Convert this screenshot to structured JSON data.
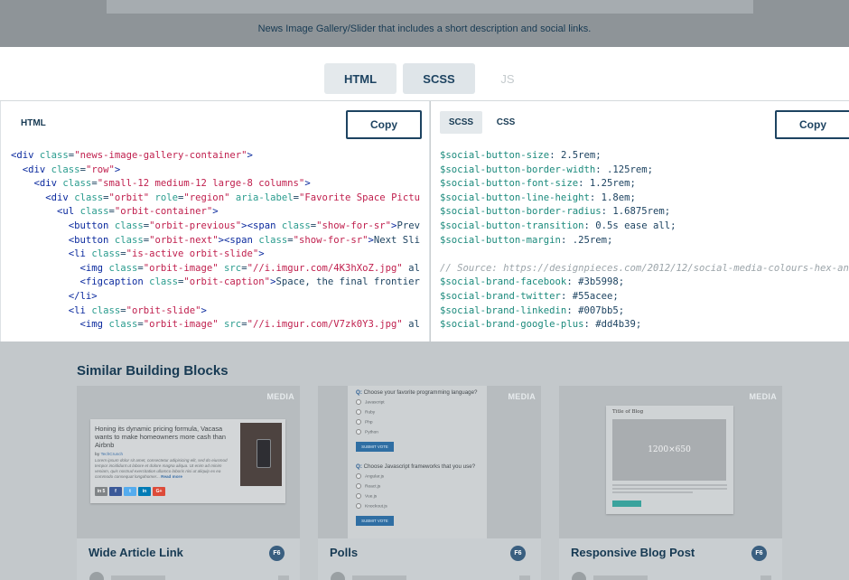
{
  "header": {
    "description": "News Image Gallery/Slider that includes a short description and social links."
  },
  "tabs": [
    {
      "label": "HTML",
      "active": false
    },
    {
      "label": "SCSS",
      "active": true
    },
    {
      "label": "JS",
      "active": false,
      "disabled": true
    }
  ],
  "html_panel": {
    "label": "HTML",
    "copy_label": "Copy",
    "lines": [
      "<div class=\"news-image-gallery-container\">",
      "  <div class=\"row\">",
      "    <div class=\"small-12 medium-12 large-8 columns\">",
      "      <div class=\"orbit\" role=\"region\" aria-label=\"Favorite Space Pictu",
      "        <ul class=\"orbit-container\">",
      "          <button class=\"orbit-previous\"><span class=\"show-for-sr\">Prev",
      "          <button class=\"orbit-next\"><span class=\"show-for-sr\">Next Sli",
      "          <li class=\"is-active orbit-slide\">",
      "            <img class=\"orbit-image\" src=\"//i.imgur.com/4K3hXoZ.jpg\" al",
      "            <figcaption class=\"orbit-caption\">Space, the final frontier",
      "          </li>",
      "          <li class=\"orbit-slide\">",
      "            <img class=\"orbit-image\" src=\"//i.imgur.com/V7zk0Y3.jpg\" al"
    ]
  },
  "scss_panel": {
    "sub_tabs": [
      "SCSS",
      "CSS"
    ],
    "copy_label": "Copy",
    "lines": [
      "$social-button-size: 2.5rem;",
      "$social-button-border-width: .125rem;",
      "$social-button-font-size: 1.25rem;",
      "$social-button-line-height: 1.8em;",
      "$social-button-border-radius: 1.6875rem;",
      "$social-button-transition: 0.5s ease all;",
      "$social-button-margin: .25rem;",
      "",
      "// Source: https://designpieces.com/2012/12/social-media-colours-hex-an",
      "$social-brand-facebook: #3b5998;",
      "$social-brand-twitter: #55acee;",
      "$social-brand-linkedin: #007bb5;",
      "$social-brand-google-plus: #dd4b39;"
    ]
  },
  "similar": {
    "title": "Similar Building Blocks",
    "cards": [
      {
        "title": "Wide Article Link",
        "tag": "MEDIA",
        "badge": "F6",
        "preview": {
          "headline": "Honing its dynamic pricing formula, Vacasa wants to make homeowners more cash than Airbnb",
          "byline_prefix": "by",
          "byline_author": "TechCrunch",
          "body": "Lorem ipsum dolor sit amet, consectetur adipisicing elit, sed do eiusmod tempor incididunt ut labore et dolore magna aliqua. Ut enim ad minim veniam, quis nostrud exercitation ullamco laboris nisi ut aliquip ex ea commodo consequat longahomer...",
          "read_more": "Read more",
          "socials": [
            "in 5",
            "f",
            "t",
            "in",
            "G+"
          ]
        }
      },
      {
        "title": "Polls",
        "tag": "MEDIA",
        "badge": "F6",
        "preview": {
          "q1_prefix": "Q:",
          "q1": "Choose your favorite programming language?",
          "q1_options": [
            "Javascript",
            "Ruby",
            "Php",
            "Python"
          ],
          "vote_label": "SUBMIT VOTE",
          "q2_prefix": "Q:",
          "q2": "Choose Javascript frameworks that you use?",
          "q2_options": [
            "Angular.js",
            "React.js",
            "Vue.js",
            "Knockout.js"
          ]
        }
      },
      {
        "title": "Responsive Blog Post",
        "tag": "MEDIA",
        "badge": "F6",
        "preview": {
          "blog_title": "Title of Blog",
          "image_text": "1200×650"
        }
      }
    ]
  },
  "colors": {
    "navy": "#1d4361",
    "tag_blue": "#0b2a9e",
    "attr_teal": "#2a9c8e",
    "string_red": "#c0204e",
    "facebook": "#3b5998",
    "twitter": "#55acee",
    "linkedin": "#007bb5",
    "google_plus": "#dd4b39"
  }
}
